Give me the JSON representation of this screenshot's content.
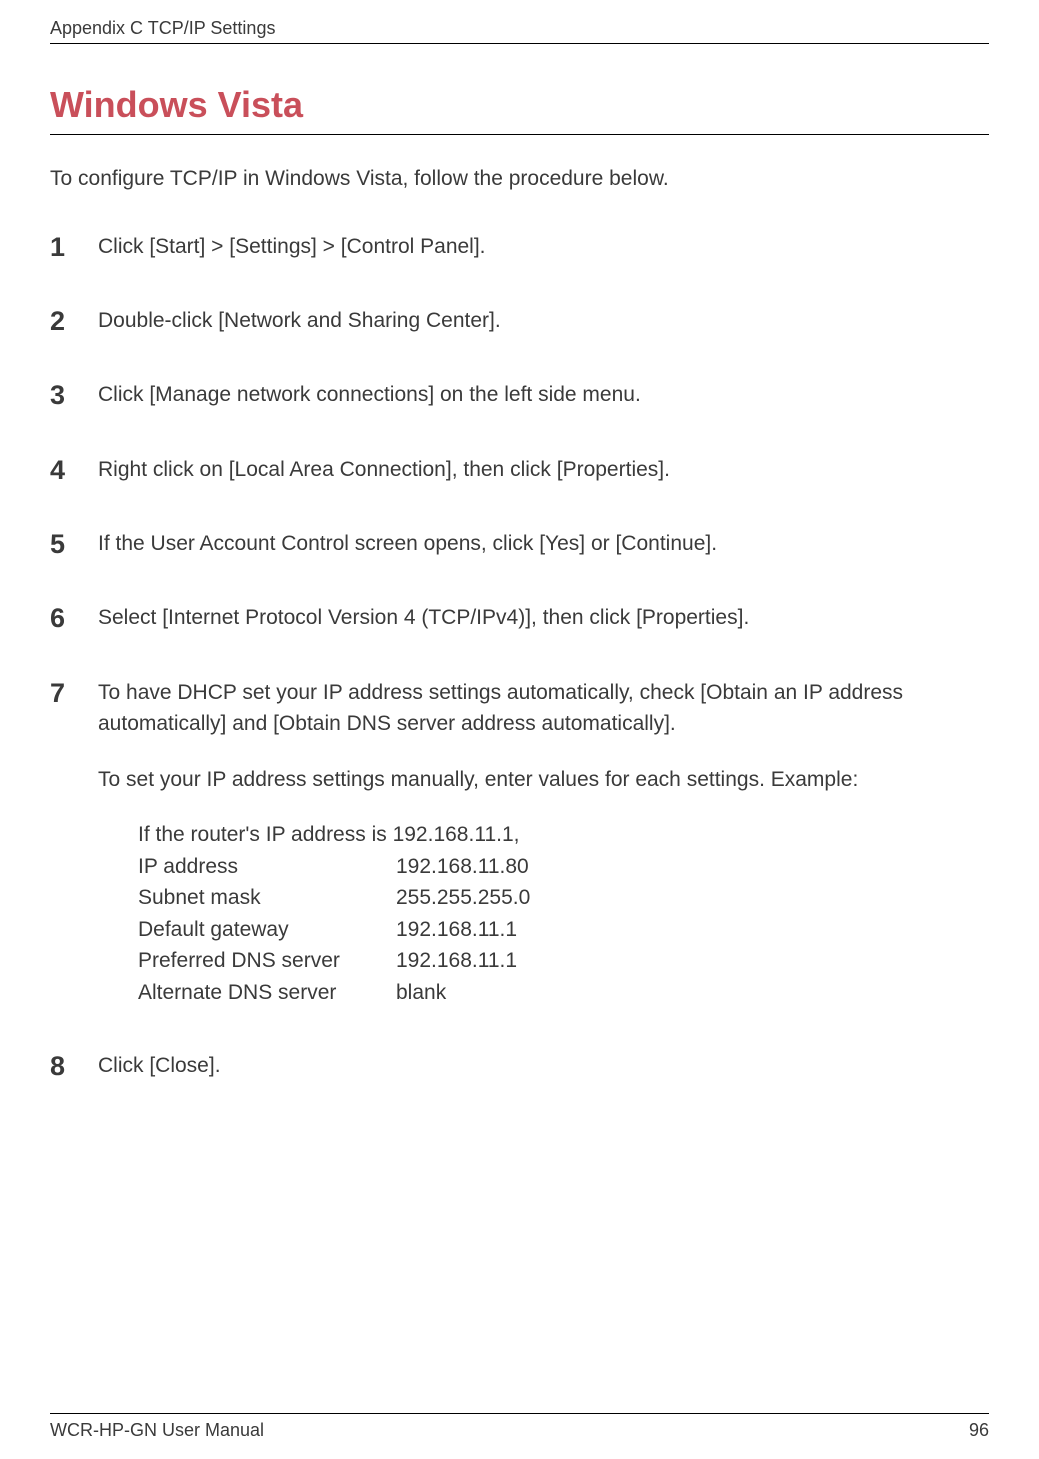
{
  "header": {
    "label": "Appendix C  TCP/IP Settings"
  },
  "title": "Windows Vista",
  "intro": "To configure TCP/IP in Windows Vista, follow the procedure below.",
  "steps": [
    {
      "num": "1",
      "text": "Click [Start] > [Settings] > [Control Panel]."
    },
    {
      "num": "2",
      "text": "Double-click [Network and Sharing Center]."
    },
    {
      "num": "3",
      "text": "Click [Manage network connections] on the left side menu."
    },
    {
      "num": "4",
      "text": "Right click on [Local Area Connection], then click [Properties]."
    },
    {
      "num": "5",
      "text": "If the User Account Control screen opens, click [Yes] or [Continue]."
    },
    {
      "num": "6",
      "text": "Select [Internet Protocol Version 4 (TCP/IPv4)], then click [Properties]."
    }
  ],
  "step7": {
    "num": "7",
    "para1": "To have DHCP set your IP address settings automatically, check [Obtain an IP address automatically] and [Obtain DNS server address automatically].",
    "para2": "To set your IP address settings manually, enter values for each settings.  Example:",
    "example_intro": "If the router's IP address is 192.168.11.1,",
    "rows": [
      {
        "label": "IP address",
        "value": "192.168.11.80"
      },
      {
        "label": "Subnet mask",
        "value": "255.255.255.0"
      },
      {
        "label": "Default gateway",
        "value": "192.168.11.1"
      },
      {
        "label": "Preferred DNS server",
        "value": "192.168.11.1"
      },
      {
        "label": "Alternate DNS server",
        "value": "blank"
      }
    ]
  },
  "step8": {
    "num": "8",
    "text": "Click [Close]."
  },
  "footer": {
    "left": "WCR-HP-GN User Manual",
    "right": "96"
  }
}
